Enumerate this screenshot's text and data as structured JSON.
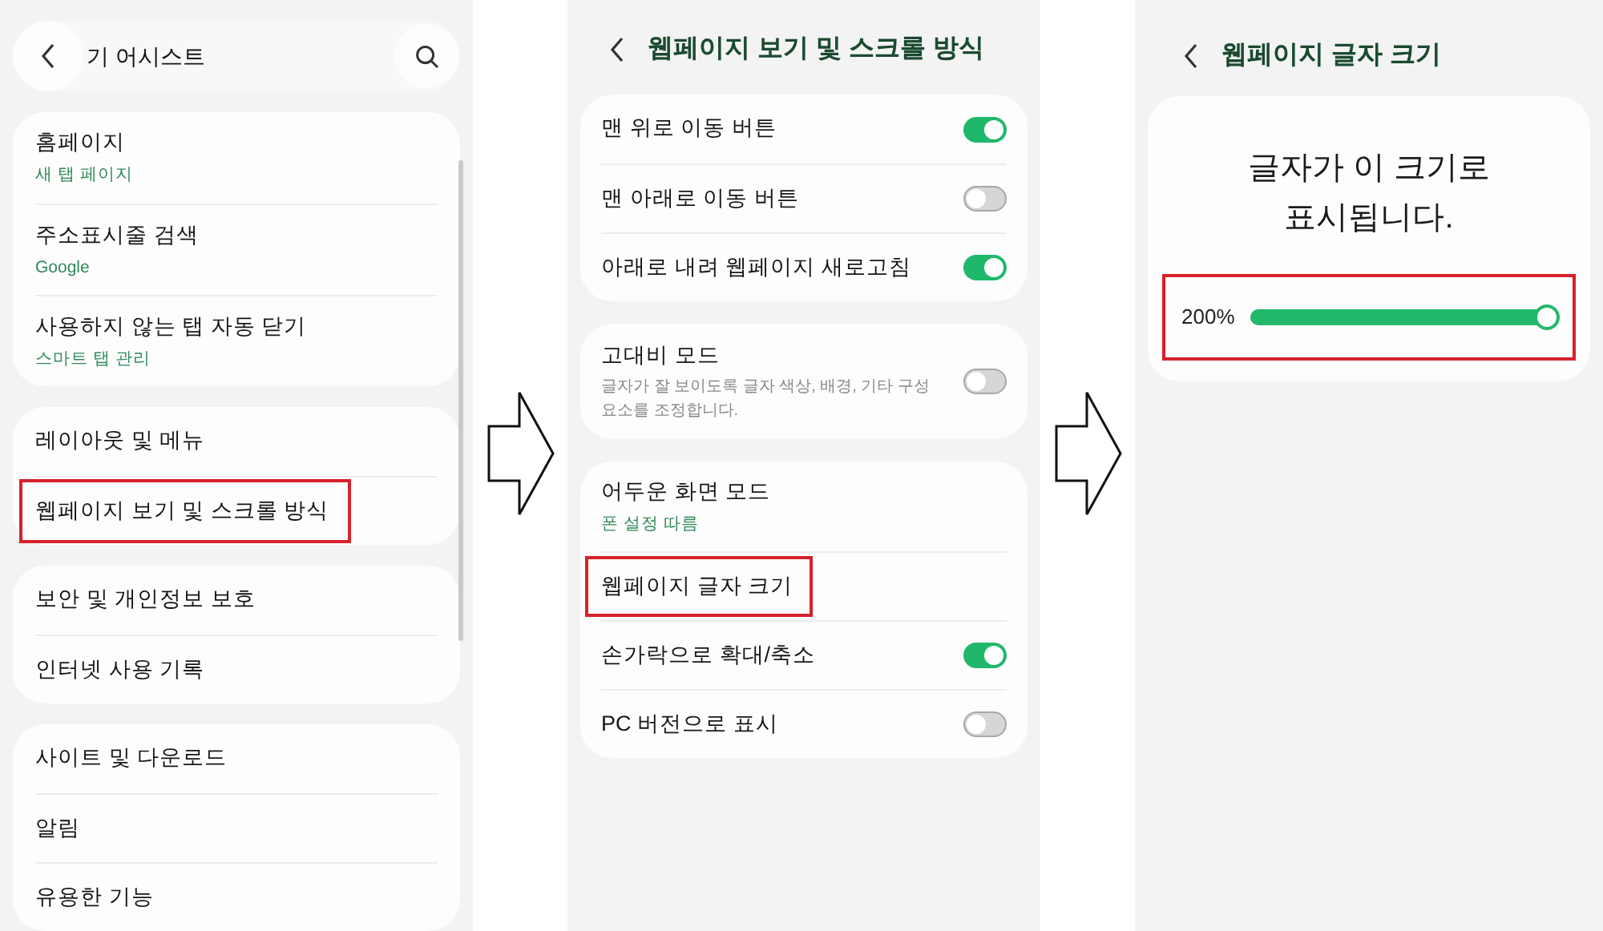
{
  "panels": [
    {
      "kind": "menu",
      "header": {
        "title": "기 어시스트"
      },
      "groups": [
        {
          "items": [
            {
              "title": "홈페이지",
              "subtitle": "새 탭 페이지",
              "highlighted": false
            },
            {
              "title": "주소표시줄 검색",
              "subtitle": "Google",
              "highlighted": false
            },
            {
              "title": "사용하지 않는 탭 자동 닫기",
              "subtitle": "스마트 탭 관리",
              "highlighted": false
            }
          ]
        },
        {
          "items": [
            {
              "title": "레이아웃 및 메뉴",
              "highlighted": false
            },
            {
              "title": "웹페이지 보기 및 스크롤 방식",
              "highlighted": true
            }
          ]
        },
        {
          "items": [
            {
              "title": "보안 및 개인정보 보호",
              "highlighted": false
            },
            {
              "title": "인터넷 사용 기록",
              "highlighted": false
            }
          ]
        },
        {
          "items": [
            {
              "title": "사이트 및 다운로드",
              "highlighted": false
            },
            {
              "title": "알림",
              "highlighted": false
            },
            {
              "title": "유용한 기능",
              "highlighted": false
            }
          ]
        }
      ]
    },
    {
      "kind": "settings",
      "title": "웹페이지 보기 및 스크롤 방식",
      "groups": [
        {
          "items": [
            {
              "kind": "toggle",
              "title": "맨 위로 이동 버튼",
              "on": true
            },
            {
              "kind": "toggle",
              "title": "맨 아래로 이동 버튼",
              "on": false
            },
            {
              "kind": "toggle",
              "title": "아래로 내려 웹페이지 새로고침",
              "on": true
            }
          ]
        },
        {
          "items": [
            {
              "kind": "toggle",
              "title": "고대비 모드",
              "description": "글자가 잘 보이도록 글자 색상, 배경, 기타 구성 요소를 조정합니다.",
              "on": false
            }
          ]
        },
        {
          "items": [
            {
              "kind": "link",
              "title": "어두운 화면 모드",
              "subtitle": "폰 설정 따름",
              "highlighted": false
            },
            {
              "kind": "link",
              "title": "웹페이지 글자 크기",
              "highlighted": true
            },
            {
              "kind": "toggle",
              "title": "손가락으로 확대/축소",
              "on": true
            },
            {
              "kind": "toggle",
              "title": "PC 버전으로 표시",
              "on": false
            }
          ]
        }
      ]
    },
    {
      "kind": "text_size",
      "title": "웹페이지 글자 크기",
      "preview": "글자가 이 크기로\n표시됩니다.",
      "slider": {
        "reading": "200%",
        "level": 1,
        "highlighted": true
      }
    }
  ]
}
